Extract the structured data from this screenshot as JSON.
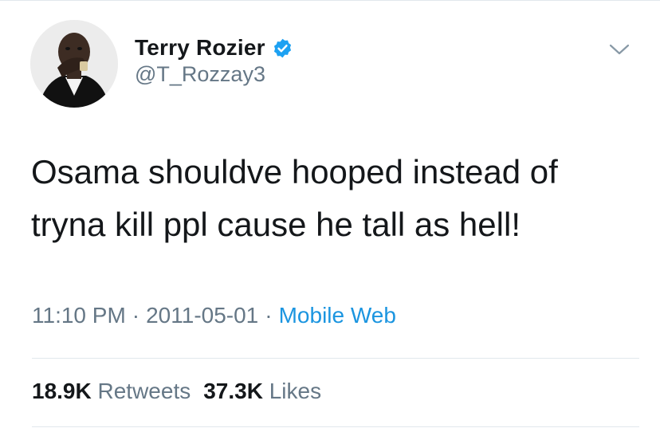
{
  "author": {
    "display_name": "Terry Rozier",
    "handle": "@T_Rozzay3",
    "verified": true,
    "avatar_icon": "profile-photo",
    "verified_icon": "verified-badge-icon",
    "menu_icon": "chevron-down-icon"
  },
  "tweet": {
    "text": "Osama shouldve hooped instead of tryna kill ppl cause he tall as hell!",
    "time": "11:10 PM",
    "separator": "·",
    "date": "2011-05-01",
    "source": "Mobile Web"
  },
  "stats": {
    "retweets_count": "18.9K",
    "retweets_label": "Retweets",
    "likes_count": "37.3K",
    "likes_label": "Likes"
  },
  "colors": {
    "text_primary": "#14171a",
    "text_secondary": "#657786",
    "link": "#1b95e0",
    "verified": "#1da1f2",
    "divider": "#e1e8ed"
  }
}
